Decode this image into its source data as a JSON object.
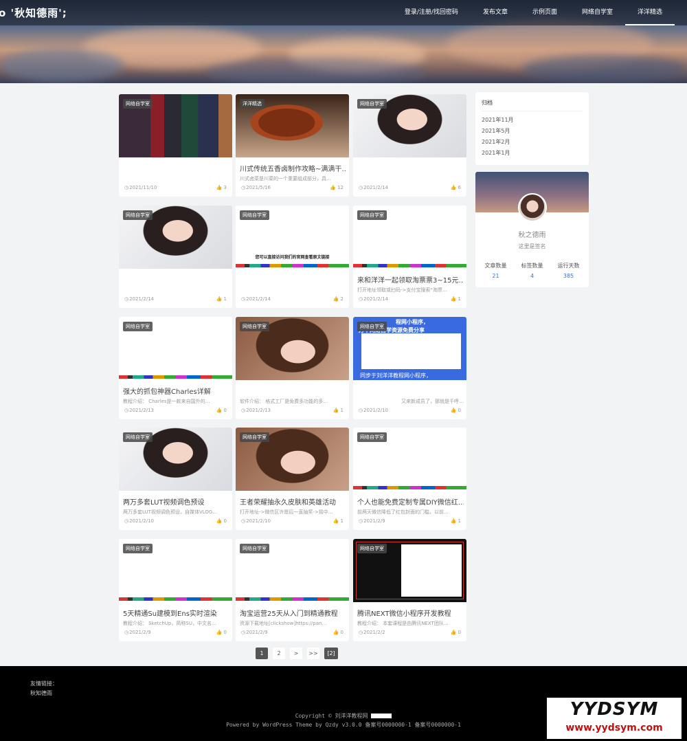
{
  "header": {
    "logo": "o '秋知德雨';",
    "nav": [
      "登录/注册/找回密码",
      "发布文章",
      "示例页面",
      "网络自学室",
      "洋洋精选"
    ]
  },
  "posts": [
    {
      "tag": "网络自学室",
      "title": "",
      "excerpt": "",
      "date": "2021/11/10",
      "likes": "3"
    },
    {
      "tag": "洋洋精选",
      "title": "川式传统五香卤制作攻略~满满干…",
      "excerpt": "川式卤菜是川菜的一个重要组成部分，具…",
      "date": "2021/5/16",
      "likes": "12"
    },
    {
      "tag": "网络自学室",
      "title": "",
      "excerpt": "",
      "date": "2021/2/14",
      "likes": "6"
    },
    {
      "tag": "网络自学室",
      "title": "",
      "excerpt": "",
      "date": "2021/2/14",
      "likes": "1"
    },
    {
      "tag": "网络自学室",
      "title": "",
      "excerpt": "",
      "date": "2021/2/14",
      "likes": "2",
      "overlay": "您可以直接访问我们的官网查看原文链接"
    },
    {
      "tag": "网络自学室",
      "title": "来和洋洋一起领取淘票票3~15元…",
      "excerpt": "打开地址领取或扫码->支付宝搜索“淘票…",
      "date": "2021/2/14",
      "likes": "1"
    },
    {
      "tag": "网络自学室",
      "title": "强大的抓包神器Charles详解",
      "excerpt": "教程介绍： Charles是一款来自国外的…",
      "date": "2021/2/13",
      "likes": "0"
    },
    {
      "tag": "网络自学室",
      "title": "",
      "excerpt": "软件介绍： 格式工厂是免费多功能的多…",
      "date": "2021/2/13",
      "likes": "1"
    },
    {
      "tag": "网络自学室",
      "title": "",
      "excerpt": "又来新成员了，那就是千呼…",
      "date": "2021/2/10",
      "likes": "0",
      "overlay1": "程网小程序，",
      "overlay1b": "万千网络自学资源免费分享",
      "overlay2": "同步于刘洋洋教程网小程序，"
    },
    {
      "tag": "网络自学室",
      "title": "两万多套LUT视频调色预设",
      "excerpt": "两万多套LUT视频调色预设，自媒体VLOG…",
      "date": "2021/2/10",
      "likes": "0"
    },
    {
      "tag": "网络自学室",
      "title": "王者荣耀抽永久皮肤和英雄活动",
      "excerpt": "打开地址->微信区许愿后一直抽奖->摇中…",
      "date": "2021/2/10",
      "likes": "1"
    },
    {
      "tag": "网络自学室",
      "title": "个人也能免费定制专属DIY微信红…",
      "excerpt": "前两天微信降低了红包封面的门槛，以前…",
      "date": "2021/2/9",
      "likes": "1"
    },
    {
      "tag": "网络自学室",
      "title": "5天精通Su建模到Ens实时渲染",
      "excerpt": "教程介绍： SketchUp，简称SU，中文名…",
      "date": "2021/2/9",
      "likes": "0"
    },
    {
      "tag": "网络自学室",
      "title": "淘宝运营25天从入门到精通教程",
      "excerpt": "资源下载地址[clickshow]https://pan…",
      "date": "2021/2/9",
      "likes": "0"
    },
    {
      "tag": "网络自学室",
      "title": "腾讯NEXT微信小程序开发教程",
      "excerpt": "教程介绍： 本套课程是由腾讯NEXT团队…",
      "date": "2021/2/2",
      "likes": "0"
    }
  ],
  "sidebar": {
    "archive_title": "归档",
    "archive": [
      "2021年11月",
      "2021年5月",
      "2021年2月",
      "2021年1月"
    ],
    "profile": {
      "name": "秋之德雨",
      "signature": "这里是签名",
      "stats": [
        {
          "label": "文章数量",
          "value": "21"
        },
        {
          "label": "标签数量",
          "value": "4"
        },
        {
          "label": "运行天数",
          "value": "385"
        }
      ]
    }
  },
  "pagination": [
    "1",
    "2",
    ">",
    ">>",
    "[2]"
  ],
  "footer": {
    "links_label": "友情链接：",
    "link1": "秋知德雨",
    "copyright": "Copyright © 刘洋洋教程网",
    "powered": "Powered by WordPress Theme by Qzdy v3.0.0  备案号0000000-1 备案号0000000-1"
  },
  "watermark": {
    "line1": "YYDSYM",
    "line2": "www.yydsym.com"
  },
  "colors": {
    "accent": "#3a6fd0",
    "footer_bg": "#000000",
    "page_bg": "#f2f3f5"
  }
}
